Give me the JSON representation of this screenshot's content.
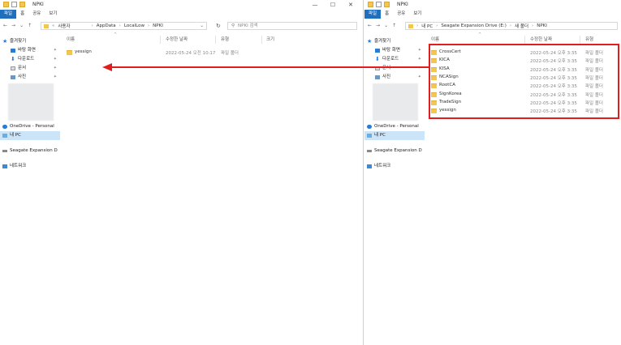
{
  "left": {
    "title": "NPKI",
    "window_controls": [
      "—",
      "☐",
      "✕"
    ],
    "ribbon_tabs": [
      "파일",
      "홈",
      "공유",
      "보기"
    ],
    "address": [
      "사용자",
      "AppData",
      "LocalLow",
      "NPKI"
    ],
    "search_placeholder": "NPKI 검색",
    "columns": {
      "name": "이름",
      "date": "수정한 날짜",
      "type": "유형",
      "size": "크기"
    },
    "files": [
      {
        "name": "yessign",
        "date": "2022-05-24 오전 10:17",
        "type": "파일 폴더"
      }
    ],
    "sidebar": {
      "quick_access": "즐겨찾기",
      "quick_items": [
        "바탕 화면",
        "다운로드",
        "문서",
        "사진"
      ],
      "onedrive": "OneDrive - Personal",
      "this_pc": "내 PC",
      "drive": "Seagate Expansion D",
      "network": "네트워크"
    }
  },
  "right": {
    "title": "NPKI",
    "ribbon_tabs": [
      "파일",
      "홈",
      "공유",
      "보기"
    ],
    "address": [
      "내 PC",
      "Seagate Expansion Drive (E:)",
      "새 폴더",
      "NPKI"
    ],
    "columns": {
      "name": "이름",
      "date": "수정한 날짜",
      "type": "유형"
    },
    "files": [
      {
        "name": "CrossCert",
        "date": "2022-05-24 오후 3:35",
        "type": "파일 폴더"
      },
      {
        "name": "KICA",
        "date": "2022-05-24 오후 3:35",
        "type": "파일 폴더"
      },
      {
        "name": "KISA",
        "date": "2022-05-24 오후 3:35",
        "type": "파일 폴더"
      },
      {
        "name": "NCASign",
        "date": "2022-05-24 오후 3:35",
        "type": "파일 폴더"
      },
      {
        "name": "RootCA",
        "date": "2022-05-24 오후 3:35",
        "type": "파일 폴더"
      },
      {
        "name": "SignKorea",
        "date": "2022-05-24 오후 3:35",
        "type": "파일 폴더"
      },
      {
        "name": "TradeSign",
        "date": "2022-05-24 오후 3:35",
        "type": "파일 폴더"
      },
      {
        "name": "yessign",
        "date": "2022-05-24 오후 3:35",
        "type": "파일 폴더"
      }
    ],
    "sidebar": {
      "quick_access": "즐겨찾기",
      "quick_items": [
        "바탕 화면",
        "다운로드",
        "문서",
        "사진"
      ],
      "onedrive": "OneDrive - Personal",
      "this_pc": "내 PC",
      "drive": "Seagate Expansion D",
      "network": "네트워크"
    }
  },
  "annotation": {
    "highlight_color": "#e11d1d",
    "arrow_color": "#e11d1d"
  },
  "colors": {
    "accent": "#1f6fbf",
    "selected": "#cce4f7",
    "folder": "#f3c74f"
  }
}
